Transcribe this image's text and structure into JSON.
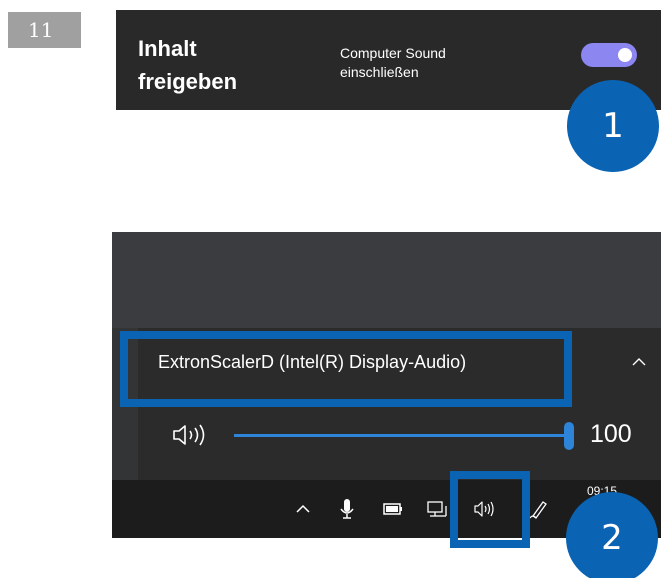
{
  "step": {
    "number": "11"
  },
  "share_bar": {
    "title_line1": "Inhalt",
    "title_line2": "freigeben",
    "sound_line1": "Computer Sound",
    "sound_line2": "einschließen",
    "toggle_state": "on",
    "toggle_color": "#8b86f0"
  },
  "markers": {
    "first": "1",
    "second": "2",
    "color": "#0a63b3"
  },
  "audio_flyout": {
    "device_name": "ExtronScalerD (Intel(R) Display-Audio)",
    "volume_value": "100",
    "volume_level": 1.0,
    "accent_color": "#2e84d8"
  },
  "taskbar": {
    "clock_partial": "09:15",
    "icons": [
      "chevron-up-icon",
      "microphone-icon",
      "battery-icon",
      "network-icon",
      "speaker-icon",
      "pen-icon"
    ]
  }
}
